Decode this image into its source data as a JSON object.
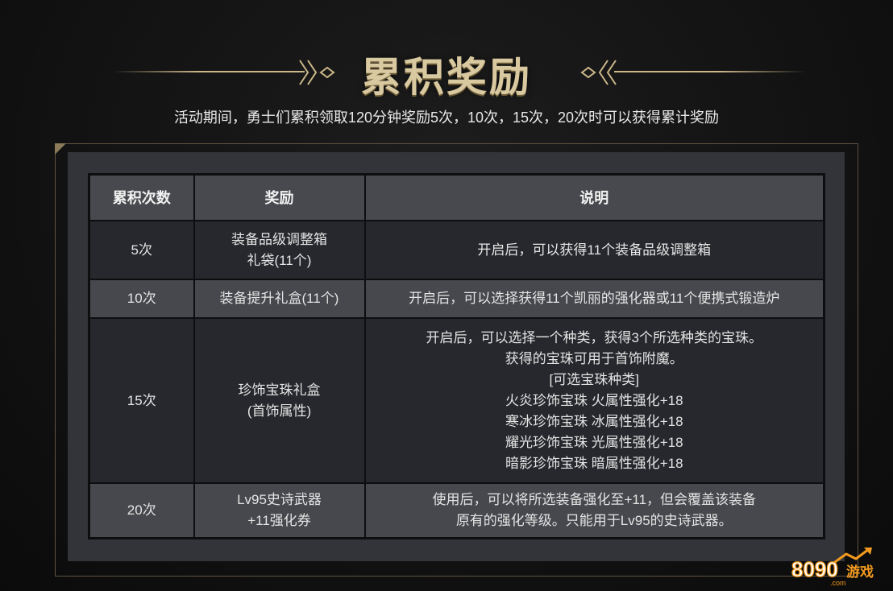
{
  "title": "累积奖励",
  "subtitle": "活动期间，勇士们累积领取120分钟奖励5次，10次，15次，20次时可以获得累计奖励",
  "table": {
    "headers": [
      "累积次数",
      "奖励",
      "说明"
    ],
    "rows": [
      {
        "count": "5次",
        "reward": [
          "装备品级调整箱",
          "礼袋(11个)"
        ],
        "desc": [
          "开启后，可以获得11个装备品级调整箱"
        ]
      },
      {
        "count": "10次",
        "reward": [
          "装备提升礼盒(11个)"
        ],
        "desc": [
          "开启后，可以选择获得11个凯丽的强化器或11个便携式锻造炉"
        ]
      },
      {
        "count": "15次",
        "reward": [
          "珍饰宝珠礼盒",
          "(首饰属性)"
        ],
        "desc": [
          "开启后，可以选择一个种类，获得3个所选种类的宝珠。",
          "获得的宝珠可用于首饰附魔。",
          "[可选宝珠种类]",
          "火炎珍饰宝珠 火属性强化+18",
          "寒冰珍饰宝珠 冰属性强化+18",
          "耀光珍饰宝珠 光属性强化+18",
          "暗影珍饰宝珠 暗属性强化+18"
        ]
      },
      {
        "count": "20次",
        "reward": [
          "Lv95史诗武器",
          "+11强化券"
        ],
        "desc": [
          "使用后，可以将所选装备强化至+11，但会覆盖该装备",
          "原有的强化等级。只能用于Lv95的史诗武器。"
        ]
      }
    ]
  },
  "watermark": {
    "number": "8090",
    "text": "游戏",
    "domain": ".com"
  },
  "colors": {
    "accent_gold": "#cbb78a",
    "title_gold": "#d9c9a0",
    "header_row": "#47494e",
    "dark_row": "#26282d",
    "light_row": "#46484d",
    "watermark_orange": "#f29a1f"
  }
}
